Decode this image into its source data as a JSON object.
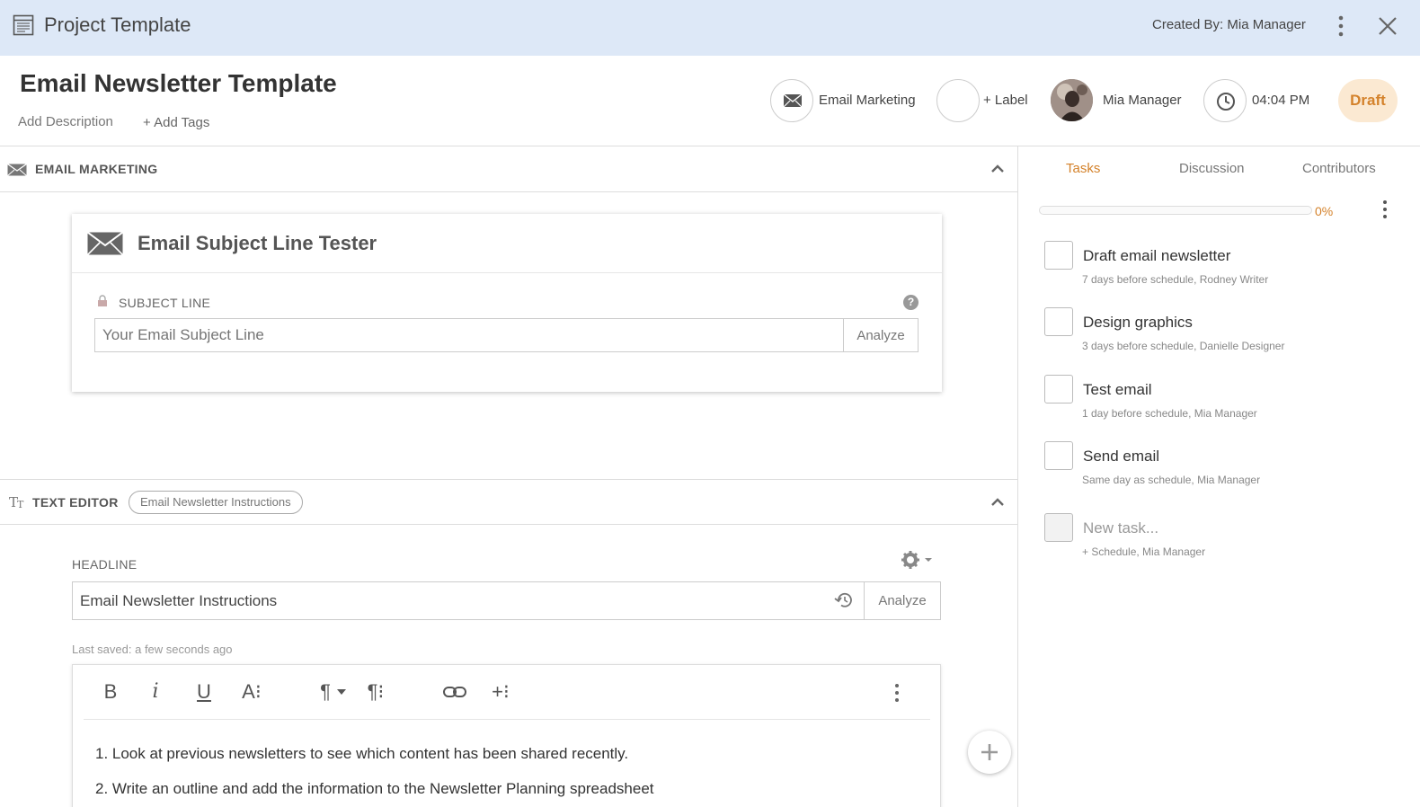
{
  "topbar": {
    "title": "Project Template",
    "created_by": "Created By: Mia Manager"
  },
  "header": {
    "title": "Email Newsletter Template",
    "add_description": "Add Description",
    "add_tags": "+ Add Tags",
    "category": "Email Marketing",
    "label": "+ Label",
    "owner": "Mia Manager",
    "time": "04:04 PM",
    "status": "Draft"
  },
  "email_section": {
    "header": "EMAIL MARKETING",
    "card_title": "Email Subject Line Tester",
    "subject_label": "SUBJECT LINE",
    "subject_placeholder": "Your Email Subject Line",
    "analyze": "Analyze",
    "help": "?"
  },
  "text_section": {
    "header": "TEXT EDITOR",
    "chip": "Email Newsletter Instructions",
    "headline_label": "HEADLINE",
    "headline_value": "Email Newsletter Instructions",
    "analyze": "Analyze",
    "last_saved": "Last saved: a few seconds ago",
    "toolbar": {
      "bold": "B",
      "italic": "i",
      "underline": "U",
      "font": "A⁝",
      "para": "¶",
      "para_format": "¶⁝",
      "insert": "+⁝"
    },
    "lines": [
      "1. Look at previous newsletters to see which content has been shared recently.",
      "2. Write an outline and add the information to the Newsletter Planning spreadsheet"
    ]
  },
  "sidebar": {
    "tabs": [
      "Tasks",
      "Discussion",
      "Contributors"
    ],
    "progress": 0,
    "progress_label": "0%",
    "tasks": [
      {
        "name": "Draft email newsletter",
        "meta": "7 days before schedule,   Rodney Writer"
      },
      {
        "name": "Design graphics",
        "meta": "3 days before schedule,   Danielle Designer"
      },
      {
        "name": "Test email",
        "meta": "1 day before schedule,   Mia Manager"
      },
      {
        "name": "Send email",
        "meta": "Same day as schedule,   Mia Manager"
      }
    ],
    "new_task": {
      "name": "New task...",
      "meta": "+ Schedule,   Mia Manager"
    }
  },
  "colors": {
    "accent": "#d4822b",
    "topbar": "#dde8f7",
    "draft_bg": "#fbe9d2"
  }
}
